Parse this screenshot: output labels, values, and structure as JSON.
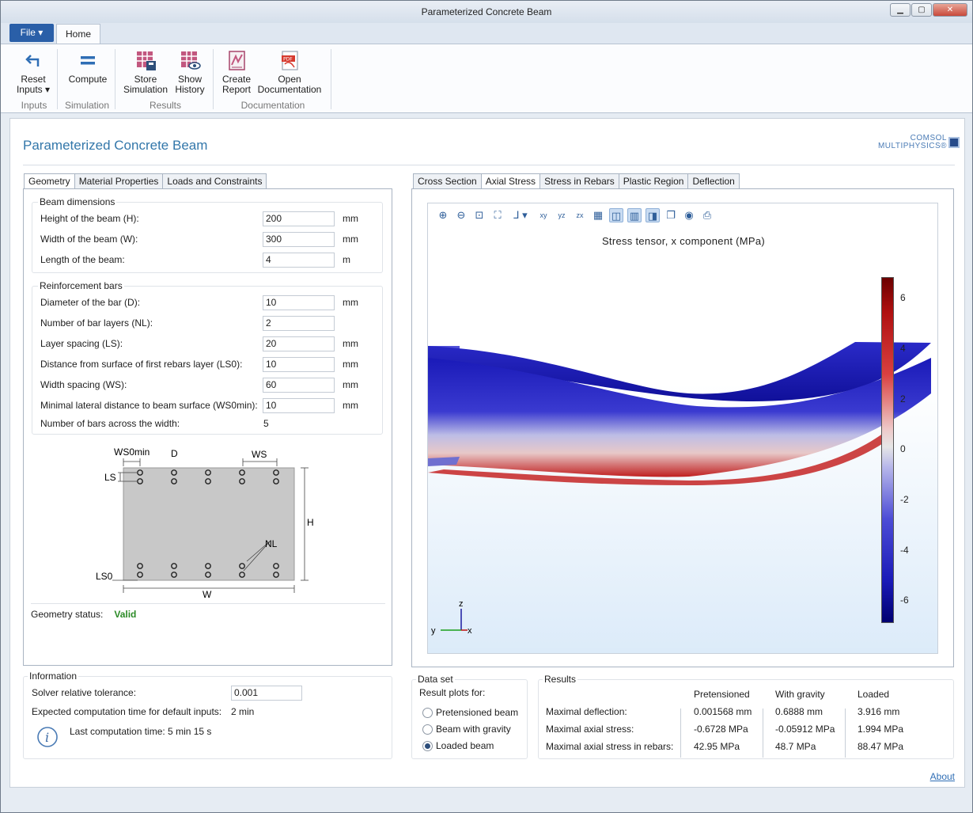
{
  "window": {
    "title": "Parameterized Concrete Beam",
    "minimize": "▁",
    "maximize": "▢",
    "close": "✕"
  },
  "menu": {
    "file": "File ▾",
    "home": "Home"
  },
  "ribbon": {
    "reset": [
      "Reset",
      "Inputs ▾"
    ],
    "compute": [
      "Compute"
    ],
    "store": [
      "Store",
      "Simulation"
    ],
    "history": [
      "Show",
      "History"
    ],
    "report": [
      "Create",
      "Report"
    ],
    "doc": [
      "Open",
      "Documentation"
    ],
    "groups": {
      "inputs": "Inputs",
      "simulation": "Simulation",
      "results": "Results",
      "documentation": "Documentation"
    }
  },
  "app": {
    "title": "Parameterized Concrete Beam",
    "logo_line1": "COMSOL",
    "logo_line2": "MULTIPHYSICS®"
  },
  "left_tabs": [
    "Geometry",
    "Material Properties",
    "Loads and Constraints"
  ],
  "beam": {
    "legend": "Beam dimensions",
    "rows": [
      {
        "label": "Height of the beam (H):",
        "value": "200",
        "unit": "mm"
      },
      {
        "label": "Width of the beam (W):",
        "value": "300",
        "unit": "mm"
      },
      {
        "label": "Length of the beam:",
        "value": "4",
        "unit": "m"
      }
    ]
  },
  "rebar": {
    "legend": "Reinforcement bars",
    "rows": [
      {
        "label": "Diameter of the bar (D):",
        "value": "10",
        "unit": "mm"
      },
      {
        "label": "Number of bar layers (NL):",
        "value": "2",
        "unit": ""
      },
      {
        "label": "Layer spacing (LS):",
        "value": "20",
        "unit": "mm"
      },
      {
        "label": "Distance from surface of first rebars layer (LS0):",
        "value": "10",
        "unit": "mm"
      },
      {
        "label": "Width spacing (WS):",
        "value": "60",
        "unit": "mm"
      },
      {
        "label": "Minimal lateral distance to beam surface (WS0min):",
        "value": "10",
        "unit": "mm"
      }
    ],
    "bars_label": "Number of bars across the width:",
    "bars_value": "5"
  },
  "sketch": {
    "ws0min": "WS0min",
    "d": "D",
    "ws": "WS",
    "ls": "LS",
    "h": "H",
    "nl": "NL",
    "ls0": "LS0",
    "w": "W"
  },
  "geometry_status": {
    "label": "Geometry status:",
    "value": "Valid"
  },
  "information": {
    "legend": "Information",
    "tol_label": "Solver relative tolerance:",
    "tol_value": "0.001",
    "exp_label": "Expected computation time for default inputs:",
    "exp_value": "2 min",
    "last": "Last computation time: 5 min 15 s"
  },
  "right_tabs": [
    "Cross Section",
    "Axial Stress",
    "Stress in Rebars",
    "Plastic Region",
    "Deflection"
  ],
  "plot": {
    "title": "Stress tensor, x component (MPa)",
    "ticks": [
      "6",
      "4",
      "2",
      "0",
      "-2",
      "-4",
      "-6"
    ],
    "axis_z": "z",
    "axis_y": "y",
    "axis_x": "x",
    "toolbar_icons": [
      "zoom-in-icon",
      "zoom-out-icon",
      "zoom-box-icon",
      "zoom-extents-icon",
      "view-axes-icon",
      "xy-view-icon",
      "yz-view-icon",
      "zx-view-icon",
      "grid-icon",
      "perspective-icon",
      "colorbar-icon",
      "lighting-icon",
      "transparency-icon",
      "camera-icon",
      "print-icon"
    ]
  },
  "dataset": {
    "legend": "Data set",
    "label": "Result plots for:",
    "options": [
      "Pretensioned beam",
      "Beam with gravity",
      "Loaded beam"
    ],
    "selected": 2
  },
  "results": {
    "legend": "Results",
    "cols": [
      "Pretensioned",
      "With gravity",
      "Loaded"
    ],
    "rows": [
      {
        "label": "Maximal deflection:",
        "v": [
          "0.001568 mm",
          "0.6888 mm",
          "3.916 mm"
        ]
      },
      {
        "label": "Maximal axial stress:",
        "v": [
          "-0.6728 MPa",
          "-0.05912 MPa",
          "1.994 MPa"
        ]
      },
      {
        "label": "Maximal axial stress in rebars:",
        "v": [
          "42.95 MPa",
          "48.7 MPa",
          "88.47 MPa"
        ]
      }
    ]
  },
  "about": "About",
  "colors": {
    "accent": "#3377aa",
    "file_button": "#2a5fa8",
    "valid": "#2b8a26"
  }
}
